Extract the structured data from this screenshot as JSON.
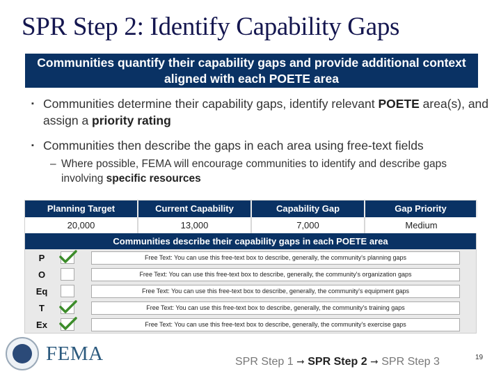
{
  "slide": {
    "title": "SPR Step 2: Identify Capability Gaps",
    "banner": "Communities quantify their capability gaps and provide additional context aligned with each POETE area",
    "bullets": [
      {
        "parts": [
          "Communities determine their capability gaps, identify relevant ",
          "POETE",
          " area(s), and assign a ",
          "priority rating"
        ]
      },
      {
        "parts": [
          "Communities then describe the gaps in each area using free-text fields"
        ]
      }
    ],
    "sub_bullet": {
      "parts": [
        "Where possible, FEMA will encourage communities to identify and describe gaps involving ",
        "specific resources"
      ]
    },
    "bullet_mark": "▪",
    "sub_mark": "–",
    "page_number": "19"
  },
  "table": {
    "headers": [
      "Planning Target",
      "Current Capability",
      "Capability Gap",
      "Gap Priority"
    ],
    "values": [
      "20,000",
      "13,000",
      "7,000",
      "Medium"
    ],
    "poete_header": "Communities describe their capability gaps in each POETE area",
    "rows": [
      {
        "label": "P",
        "checked": true,
        "text": "Free Text: You can use this free-text box to describe, generally, the community's planning gaps"
      },
      {
        "label": "O",
        "checked": false,
        "text": "Free Text: You can use this free-text box to describe, generally, the community's organization gaps"
      },
      {
        "label": "Eq",
        "checked": false,
        "text": "Free Text: You can use this free-text box to describe, generally, the community's equipment gaps"
      },
      {
        "label": "T",
        "checked": true,
        "text": "Free Text: You can use this free-text box to describe, generally, the community's training gaps"
      },
      {
        "label": "Ex",
        "checked": true,
        "text": "Free Text: You can use this free-text box to describe, generally, the community's exercise gaps"
      }
    ]
  },
  "footer": {
    "logo_text": "FEMA",
    "logo_icon": "dhs-seal-icon",
    "steps": [
      "SPR Step 1",
      "SPR Step 2",
      "SPR Step 3"
    ],
    "arrow": "➞",
    "current_step": 1
  },
  "colors": {
    "title": "#14164f",
    "banner_bg": "#0a3264",
    "check": "#3c8c2a",
    "fema_text": "#2c5a7e"
  }
}
